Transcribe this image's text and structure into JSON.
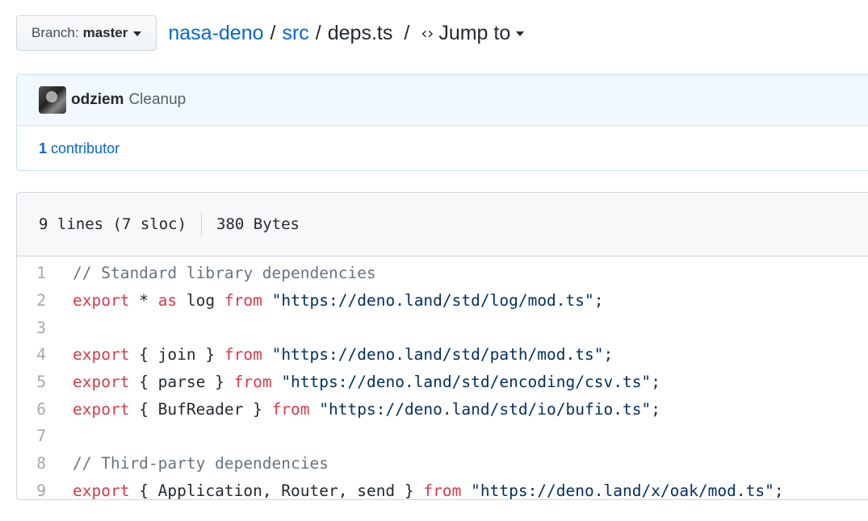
{
  "branch": {
    "label": "Branch:",
    "name": "master"
  },
  "breadcrumb": {
    "repo": "nasa-deno",
    "dir": "src",
    "file": "deps.ts",
    "sep1": "/",
    "sep2": "/",
    "sep3": "/",
    "jump_label": "Jump to"
  },
  "commit": {
    "author": "odziem",
    "message": "Cleanup"
  },
  "contributors": {
    "count": "1",
    "label": "contributor"
  },
  "file_info": {
    "lines": "9 lines (7 sloc)",
    "size": "380 Bytes"
  },
  "code": {
    "l1": {
      "num": "1",
      "comment": "// Standard library dependencies"
    },
    "l2": {
      "num": "2",
      "kw1": "export",
      "t1": " * ",
      "kw2": "as",
      "t2": " log ",
      "kw3": "from",
      "t3": " ",
      "str": "\"https://deno.land/std/log/mod.ts\"",
      "t4": ";"
    },
    "l3": {
      "num": "3"
    },
    "l4": {
      "num": "4",
      "kw1": "export",
      "t1": " { join } ",
      "kw2": "from",
      "t2": " ",
      "str": "\"https://deno.land/std/path/mod.ts\"",
      "t3": ";"
    },
    "l5": {
      "num": "5",
      "kw1": "export",
      "t1": " { parse } ",
      "kw2": "from",
      "t2": " ",
      "str": "\"https://deno.land/std/encoding/csv.ts\"",
      "t3": ";"
    },
    "l6": {
      "num": "6",
      "kw1": "export",
      "t1": " { BufReader } ",
      "kw2": "from",
      "t2": " ",
      "str": "\"https://deno.land/std/io/bufio.ts\"",
      "t3": ";"
    },
    "l7": {
      "num": "7"
    },
    "l8": {
      "num": "8",
      "comment": "// Third-party dependencies"
    },
    "l9": {
      "num": "9",
      "kw1": "export",
      "t1": " { Application, Router, send } ",
      "kw2": "from",
      "t2": " ",
      "str": "\"https://deno.land/x/oak/mod.ts\"",
      "t3": ";"
    }
  },
  "colors": {
    "link": "#0366d6",
    "keyword": "#d73a49",
    "string": "#032f62",
    "comment": "#6a737d"
  }
}
